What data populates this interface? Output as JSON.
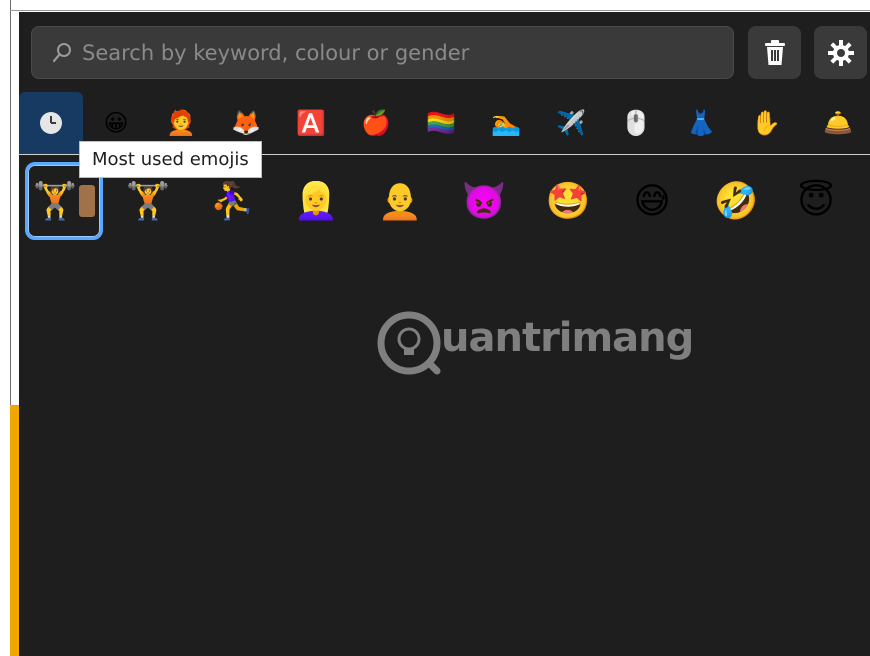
{
  "search": {
    "placeholder": "Search by keyword, colour or gender"
  },
  "toolbar": {
    "trash_icon": "trash-icon",
    "settings_icon": "gear-icon"
  },
  "tabs": [
    {
      "name": "most-used",
      "glyph": "🕒"
    },
    {
      "name": "smileys",
      "glyph": "😀"
    },
    {
      "name": "people",
      "glyph": "🧑‍🦰"
    },
    {
      "name": "animals",
      "glyph": "🦊"
    },
    {
      "name": "symbols",
      "glyph": "🅰️"
    },
    {
      "name": "food",
      "glyph": "🍎"
    },
    {
      "name": "flags",
      "glyph": "🏳️‍🌈"
    },
    {
      "name": "activities",
      "glyph": "🏊"
    },
    {
      "name": "travel",
      "glyph": "✈️"
    },
    {
      "name": "objects",
      "glyph": "🖱️"
    },
    {
      "name": "clothing",
      "glyph": "👗"
    },
    {
      "name": "hands",
      "glyph": "✋"
    },
    {
      "name": "more",
      "glyph": "🛎️"
    }
  ],
  "tooltip": {
    "text": "Most used emojis"
  },
  "recent_emojis": [
    {
      "name": "weightlifter-with-skin-tone",
      "glyph": "🏋️"
    },
    {
      "name": "weightlifter",
      "glyph": "🏋️"
    },
    {
      "name": "person-bouncing-ball",
      "glyph": "⛹️‍♀️"
    },
    {
      "name": "woman-blond",
      "glyph": "👱‍♀️"
    },
    {
      "name": "bald-person",
      "glyph": "🧑‍🦲"
    },
    {
      "name": "angry-devil",
      "glyph": "👿"
    },
    {
      "name": "star-struck",
      "glyph": "🤩"
    },
    {
      "name": "grinning-sweat",
      "glyph": "😅"
    },
    {
      "name": "rolling-laughing",
      "glyph": "🤣"
    },
    {
      "name": "smiling-halo",
      "glyph": "😇"
    }
  ],
  "watermark": {
    "text": "uantrimang"
  },
  "colors": {
    "panel_bg": "#1e1e1e",
    "active_tab": "#163a62",
    "selection": "#5aa8ff",
    "accent_strip": "#f0a800"
  }
}
